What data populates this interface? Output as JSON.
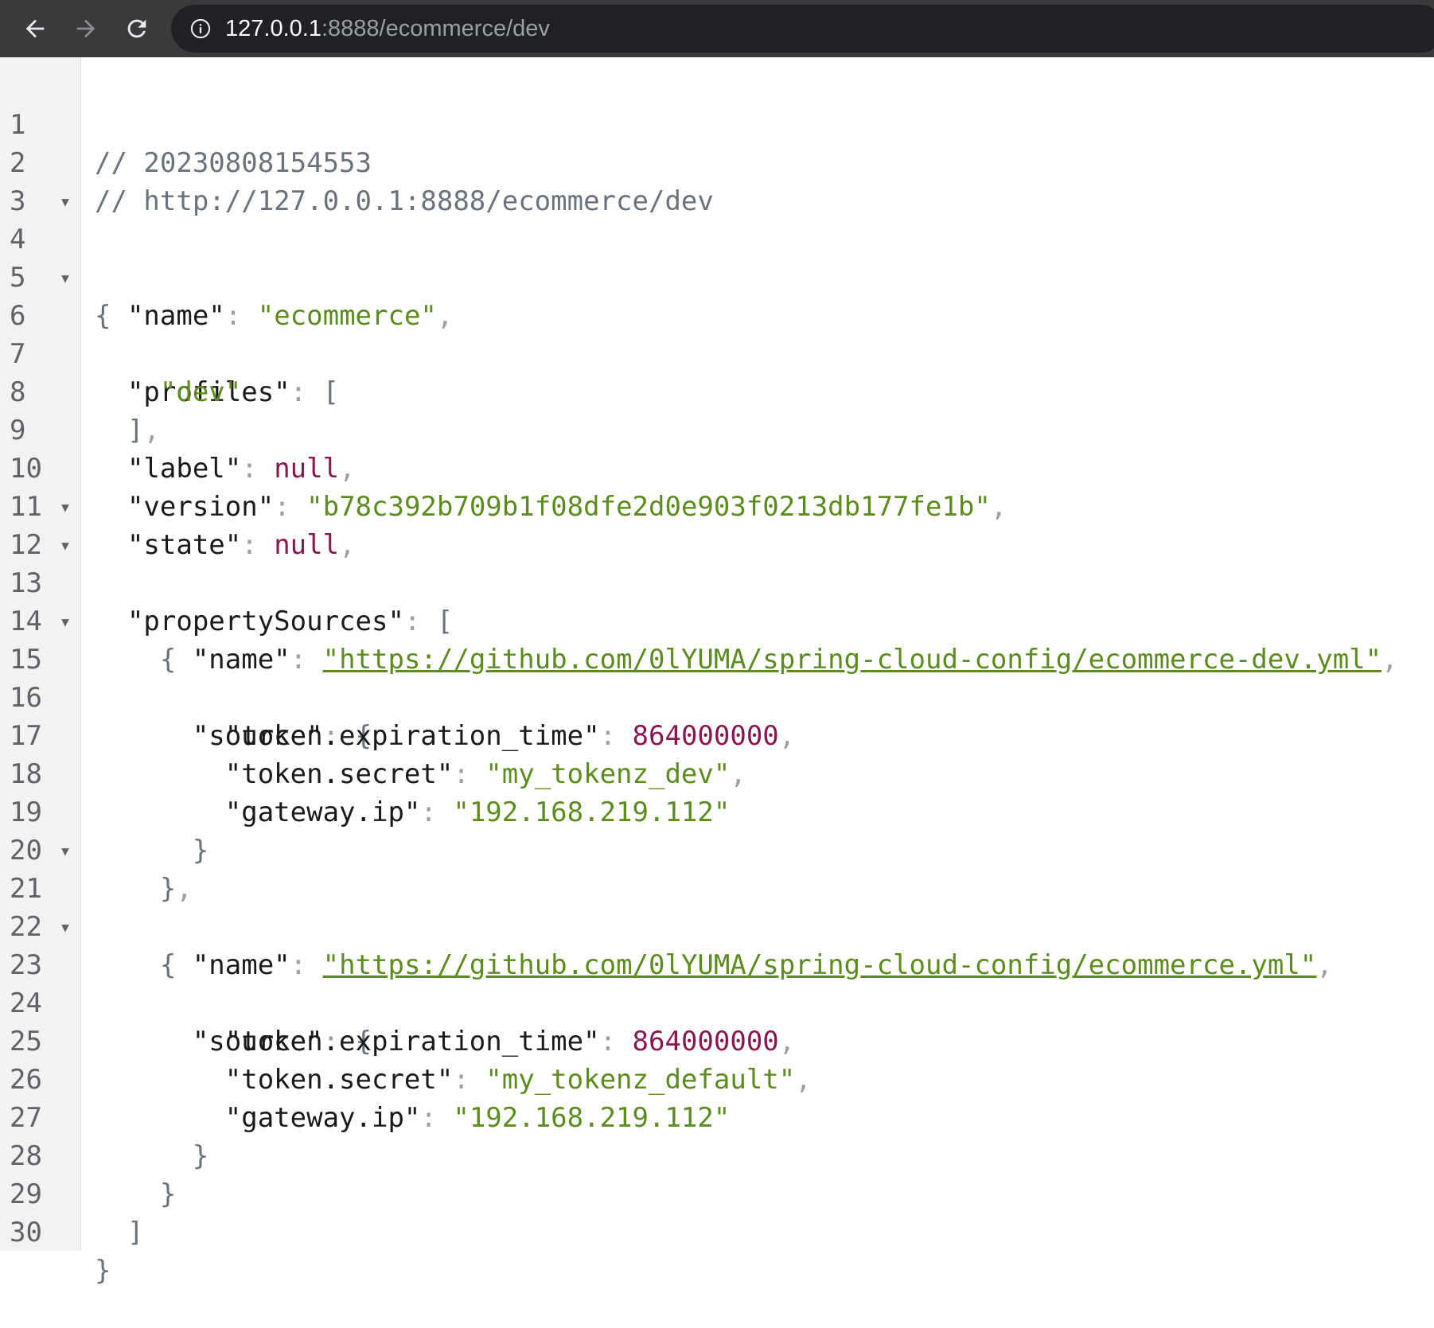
{
  "browser": {
    "url_host": "127.0.0.1",
    "url_rest": ":8888/ecommerce/dev"
  },
  "json_view": {
    "header_comments": [
      "// 20230808154553",
      "// http://127.0.0.1:8888/ecommerce/dev"
    ],
    "name_key": "\"name\"",
    "name_value": "\"ecommerce\"",
    "profiles_key": "\"profiles\"",
    "profiles": [
      "\"dev\""
    ],
    "label_key": "\"label\"",
    "label_value": "null",
    "version_key": "\"version\"",
    "version_value": "\"b78c392b709b1f08dfe2d0e903f0213db177fe1b\"",
    "state_key": "\"state\"",
    "state_value": "null",
    "property_sources_key": "\"propertySources\"",
    "source_key": "\"source\"",
    "token_expiration_key": "\"token.expiration_time\"",
    "token_secret_key": "\"token.secret\"",
    "gateway_ip_key": "\"gateway.ip\"",
    "property_sources": [
      {
        "name": "\"https://github.com/0lYUMA/spring-cloud-config/ecommerce-dev.yml\"",
        "token_expiration_time": "864000000",
        "token_secret": "\"my_tokenz_dev\"",
        "gateway_ip": "\"192.168.219.112\""
      },
      {
        "name": "\"https://github.com/0lYUMA/spring-cloud-config/ecommerce.yml\"",
        "token_expiration_time": "864000000",
        "token_secret": "\"my_tokenz_default\"",
        "gateway_ip": "\"192.168.219.112\""
      }
    ]
  },
  "line_numbers": [
    "1",
    "2",
    "3",
    "4",
    "5",
    "6",
    "7",
    "8",
    "9",
    "10",
    "11",
    "12",
    "13",
    "14",
    "15",
    "16",
    "17",
    "18",
    "19",
    "20",
    "21",
    "22",
    "23",
    "24",
    "25",
    "26",
    "27",
    "28",
    "29",
    "30"
  ]
}
